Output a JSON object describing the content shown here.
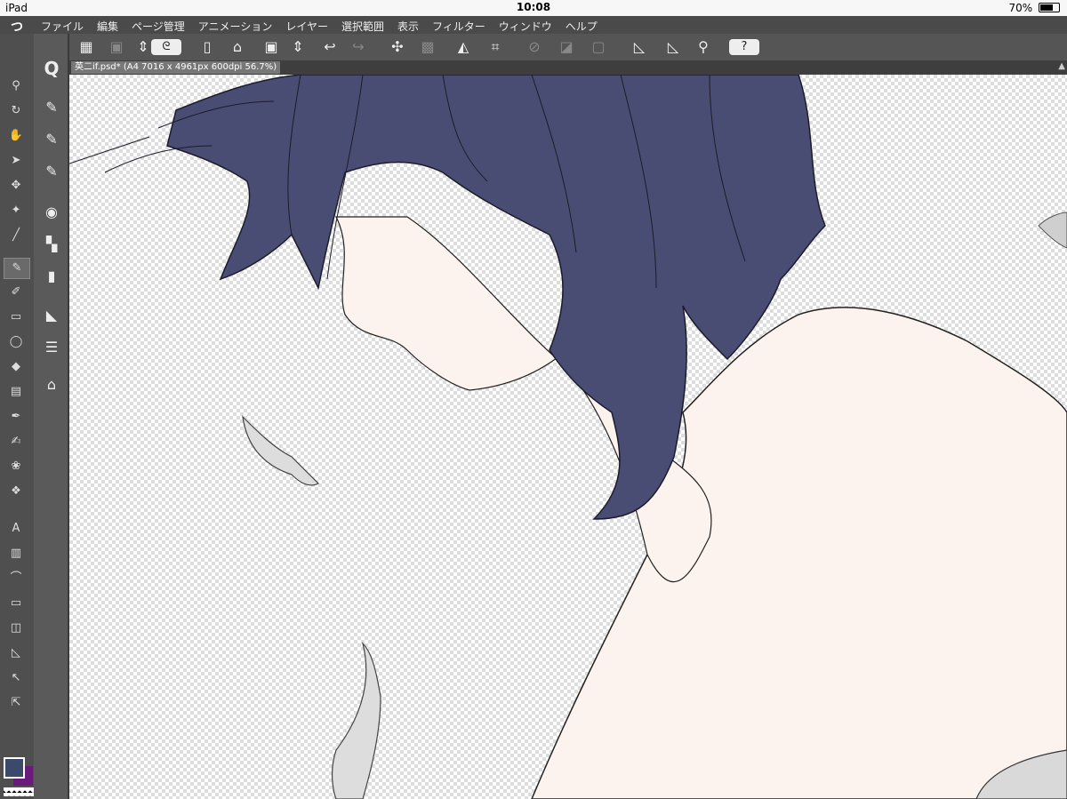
{
  "status_bar": {
    "device": "iPad",
    "time": "10:08",
    "battery": "70%",
    "battery_level": 0.7
  },
  "menu": {
    "logo": "つ",
    "items": [
      "ファイル",
      "編集",
      "ページ管理",
      "アニメーション",
      "レイヤー",
      "選択範囲",
      "表示",
      "フィルター",
      "ウィンドウ",
      "ヘルプ"
    ]
  },
  "command_bar": {
    "buttons": [
      {
        "name": "layout-icon",
        "glyph": "▦",
        "dim": false
      },
      {
        "name": "material-icon",
        "glyph": "▣",
        "dim": true
      },
      {
        "name": "up-down-icon",
        "glyph": "⇕",
        "dim": false
      },
      {
        "name": "clip-studio-icon",
        "glyph": "ᘓ",
        "dim": false,
        "pill": true
      },
      {
        "name": "new-file-icon",
        "glyph": "▯",
        "dim": false
      },
      {
        "name": "open-folder-icon",
        "glyph": "⌂",
        "dim": false
      },
      {
        "name": "save-icon",
        "glyph": "▣",
        "dim": false
      },
      {
        "name": "page-updown-icon",
        "glyph": "⇕",
        "dim": false
      },
      {
        "name": "undo-icon",
        "glyph": "↩",
        "dim": false
      },
      {
        "name": "redo-icon",
        "glyph": "↪",
        "dim": true
      },
      {
        "name": "clear-icon",
        "glyph": "✣",
        "dim": false
      },
      {
        "name": "clear-outside-icon",
        "glyph": "▩",
        "dim": true
      },
      {
        "name": "fill-icon",
        "glyph": "◭",
        "dim": false
      },
      {
        "name": "transform-icon",
        "glyph": "⌗",
        "dim": false
      },
      {
        "name": "deselect-icon",
        "glyph": "⊘",
        "dim": true
      },
      {
        "name": "invert-selection-icon",
        "glyph": "◪",
        "dim": true
      },
      {
        "name": "show-selection-icon",
        "glyph": "▢",
        "dim": true
      },
      {
        "name": "ruler-snap-icon",
        "glyph": "◺",
        "dim": false
      },
      {
        "name": "special-ruler-snap-icon",
        "glyph": "◺",
        "dim": false
      },
      {
        "name": "grid-snap-icon",
        "glyph": "⚲",
        "dim": false
      },
      {
        "name": "help-icon",
        "glyph": "?",
        "dim": false,
        "pill": true
      }
    ]
  },
  "document": {
    "title": "英二if.psd* (A4 7016 x 4961px 600dpi 56.7%)",
    "scroll_glyph": "▲"
  },
  "toolbox": {
    "tools": [
      {
        "name": "zoom-tool-icon",
        "glyph": "⚲"
      },
      {
        "name": "rotate-tool-icon",
        "glyph": "↻"
      },
      {
        "name": "hand-tool-icon",
        "glyph": "✋"
      },
      {
        "name": "operation-tool-icon",
        "glyph": "➤"
      },
      {
        "name": "move-tool-icon",
        "glyph": "✥"
      },
      {
        "name": "auto-select-tool-icon",
        "glyph": "✦"
      },
      {
        "name": "eyedropper-tool-icon",
        "glyph": "╱"
      },
      {
        "name": "pen-tool-icon",
        "glyph": "✎",
        "selected": true
      },
      {
        "name": "brush-tool-icon",
        "glyph": "✐"
      },
      {
        "name": "eraser-tool-icon",
        "glyph": "▭"
      },
      {
        "name": "lasso-tool-icon",
        "glyph": "◯"
      },
      {
        "name": "fill-tool-icon",
        "glyph": "◆"
      },
      {
        "name": "gradient-tool-icon",
        "glyph": "▤"
      },
      {
        "name": "blend-tool-icon",
        "glyph": "✒"
      },
      {
        "name": "airbrush-tool-icon",
        "glyph": "✍"
      },
      {
        "name": "decoration-tool-icon",
        "glyph": "❀"
      },
      {
        "name": "mesh-tool-icon",
        "glyph": "❖"
      },
      {
        "name": "text-tool-icon",
        "glyph": "A"
      },
      {
        "name": "frame-tool-icon",
        "glyph": "▥"
      },
      {
        "name": "balloon-tool-icon",
        "glyph": "⌒"
      },
      {
        "name": "figure-tool-icon",
        "glyph": "▭"
      },
      {
        "name": "frame-border-tool-icon",
        "glyph": "◫"
      },
      {
        "name": "ruler-tool-icon",
        "glyph": "◺"
      },
      {
        "name": "correction-tool-icon",
        "glyph": "↖"
      },
      {
        "name": "line-correction-tool-icon",
        "glyph": "⇱"
      }
    ]
  },
  "side_panel": {
    "buttons": [
      {
        "name": "quick-access-icon",
        "glyph": "Q"
      },
      {
        "name": "subtool-icon",
        "glyph": "✎"
      },
      {
        "name": "tool-property-icon",
        "glyph": "✎"
      },
      {
        "name": "brush-size-icon",
        "glyph": "✎"
      },
      {
        "name": "color-wheel-icon",
        "glyph": "◉"
      },
      {
        "name": "color-set-icon",
        "glyph": "▚"
      },
      {
        "name": "timeline-icon",
        "glyph": "▮"
      },
      {
        "name": "navigator-icon",
        "glyph": "◣"
      },
      {
        "name": "layers-icon",
        "glyph": "☰"
      },
      {
        "name": "material-folder-icon",
        "glyph": "⌂"
      }
    ]
  },
  "colors": {
    "accent": "#4a4d73",
    "foreground": "#3b4a6b",
    "background": "#6a1a7a",
    "skin": "#fdf3ee",
    "hair": "#4a4d73"
  }
}
